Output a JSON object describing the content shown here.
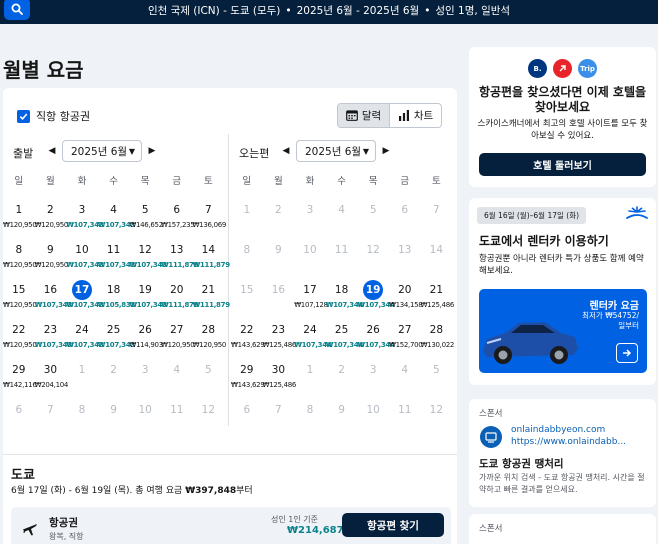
{
  "header": {
    "route": "인천 국제 (ICN) - 도쿄 (모두)",
    "dates": "2025년 6월 - 2025년 6월",
    "travellers": "성인 1명, 일반석"
  },
  "page_title": "월별 요금",
  "filters": {
    "direct_label": "직항 항공권",
    "direct_checked": true,
    "view_calendar": "달력",
    "view_chart": "차트"
  },
  "weekdays": [
    "일",
    "월",
    "화",
    "수",
    "목",
    "금",
    "토"
  ],
  "outbound": {
    "label": "출발",
    "month": "2025년 6월",
    "rows": [
      [
        {
          "d": "1",
          "p": "₩120,950"
        },
        {
          "d": "2",
          "p": "₩120,950"
        },
        {
          "d": "3",
          "p": "₩107,343",
          "g": true
        },
        {
          "d": "4",
          "p": "₩107,343",
          "g": true
        },
        {
          "d": "5",
          "p": "₩146,652"
        },
        {
          "d": "6",
          "p": "₩157,235"
        },
        {
          "d": "7",
          "p": "₩136,069"
        }
      ],
      [
        {
          "d": "8",
          "p": "₩120,950"
        },
        {
          "d": "9",
          "p": "₩120,950"
        },
        {
          "d": "10",
          "p": "₩107,343",
          "g": true
        },
        {
          "d": "11",
          "p": "₩107,343",
          "g": true
        },
        {
          "d": "12",
          "p": "₩107,343",
          "g": true
        },
        {
          "d": "13",
          "p": "₩111,879",
          "g": true
        },
        {
          "d": "14",
          "p": "₩111,879",
          "g": true
        }
      ],
      [
        {
          "d": "15",
          "p": "₩120,950"
        },
        {
          "d": "16",
          "p": "₩107,343",
          "g": true
        },
        {
          "d": "17",
          "p": "₩107,343",
          "g": true,
          "sel": true
        },
        {
          "d": "18",
          "p": "₩105,831",
          "g": true
        },
        {
          "d": "19",
          "p": "₩107,343",
          "g": true
        },
        {
          "d": "20",
          "p": "₩111,879",
          "g": true
        },
        {
          "d": "21",
          "p": "₩111,879",
          "g": true
        }
      ],
      [
        {
          "d": "22",
          "p": "₩120,950"
        },
        {
          "d": "23",
          "p": "₩107,343",
          "g": true
        },
        {
          "d": "24",
          "p": "₩107,343",
          "g": true
        },
        {
          "d": "25",
          "p": "₩107,343",
          "g": true
        },
        {
          "d": "26",
          "p": "₩114,903"
        },
        {
          "d": "27",
          "p": "₩120,950"
        },
        {
          "d": "28",
          "p": "₩120,950"
        }
      ],
      [
        {
          "d": "29",
          "p": "₩142,116"
        },
        {
          "d": "30",
          "p": "₩204,104"
        },
        {
          "d": "1",
          "dim": true
        },
        {
          "d": "2",
          "dim": true
        },
        {
          "d": "3",
          "dim": true
        },
        {
          "d": "4",
          "dim": true
        },
        {
          "d": "5",
          "dim": true
        }
      ],
      [
        {
          "d": "6",
          "dim": true
        },
        {
          "d": "7",
          "dim": true
        },
        {
          "d": "8",
          "dim": true
        },
        {
          "d": "9",
          "dim": true
        },
        {
          "d": "10",
          "dim": true
        },
        {
          "d": "11",
          "dim": true
        },
        {
          "d": "12",
          "dim": true
        }
      ]
    ]
  },
  "inbound": {
    "label": "오는편",
    "month": "2025년 6월",
    "rows": [
      [
        {
          "d": "1",
          "dim": true
        },
        {
          "d": "2",
          "dim": true
        },
        {
          "d": "3",
          "dim": true
        },
        {
          "d": "4",
          "dim": true
        },
        {
          "d": "5",
          "dim": true
        },
        {
          "d": "6",
          "dim": true
        },
        {
          "d": "7",
          "dim": true
        }
      ],
      [
        {
          "d": "8",
          "dim": true
        },
        {
          "d": "9",
          "dim": true
        },
        {
          "d": "10",
          "dim": true
        },
        {
          "d": "11",
          "dim": true
        },
        {
          "d": "12",
          "dim": true
        },
        {
          "d": "13",
          "dim": true
        },
        {
          "d": "14",
          "dim": true
        }
      ],
      [
        {
          "d": "15",
          "dim": true
        },
        {
          "d": "16",
          "dim": true
        },
        {
          "d": "17",
          "p": "₩107,128"
        },
        {
          "d": "18",
          "p": "₩107,344",
          "g": true
        },
        {
          "d": "19",
          "p": "₩107,344",
          "g": true,
          "sel": true
        },
        {
          "d": "20",
          "p": "₩134,158"
        },
        {
          "d": "21",
          "p": "₩125,486"
        }
      ],
      [
        {
          "d": "22",
          "p": "₩143,629"
        },
        {
          "d": "23",
          "p": "₩125,486"
        },
        {
          "d": "24",
          "p": "₩107,344",
          "g": true
        },
        {
          "d": "25",
          "p": "₩107,344",
          "g": true
        },
        {
          "d": "26",
          "p": "₩107,344",
          "g": true
        },
        {
          "d": "27",
          "p": "₩152,700"
        },
        {
          "d": "28",
          "p": "₩130,022"
        }
      ],
      [
        {
          "d": "29",
          "p": "₩143,629"
        },
        {
          "d": "30",
          "p": "₩125,486"
        },
        {
          "d": "1",
          "dim": true
        },
        {
          "d": "2",
          "dim": true
        },
        {
          "d": "3",
          "dim": true
        },
        {
          "d": "4",
          "dim": true
        },
        {
          "d": "5",
          "dim": true
        }
      ],
      [
        {
          "d": "6",
          "dim": true
        },
        {
          "d": "7",
          "dim": true
        },
        {
          "d": "8",
          "dim": true
        },
        {
          "d": "9",
          "dim": true
        },
        {
          "d": "10",
          "dim": true
        },
        {
          "d": "11",
          "dim": true
        },
        {
          "d": "12",
          "dim": true
        }
      ]
    ]
  },
  "summary": {
    "city": "도쿄",
    "dates_text": "6월 17일 (화) - 6월 19일 (목). 총 여행 요금 ",
    "total": "₩397,848",
    "total_suffix": "부터",
    "flight_title": "항공권",
    "flight_sub": "왕복, 직항",
    "from_label": "성인 1인 기준",
    "from_price": "₩214,687",
    "find_button": "항공편 찾기"
  },
  "hotel_promo": {
    "logos": [
      "B.",
      "Trip"
    ],
    "title": "항공편을 찾으셨다면 이제 호텔을 찾아보세요",
    "desc": "스카이스캐너에서 최고의 호텔 사이트를 모두 찾아보실 수 있어요.",
    "button": "호텔 둘러보기"
  },
  "car_promo": {
    "date_pill": "6월 16일 (월)–6월 17일 (화)",
    "title": "도쿄에서 렌터카 이용하기",
    "desc": "항공권뿐 아니라 렌터카 특가 상품도 함께 예약해보세요.",
    "banner_title": "렌터카 요금",
    "banner_sub1": "최저가 ₩54752/",
    "banner_sub2": "일부터"
  },
  "sponsor": {
    "label": "스폰서",
    "domain": "onlaindabbyeon.com",
    "url": "https://www.onlaindabb...",
    "title": "도쿄 항공권 땡처리",
    "desc": "가까운 위치 검색 - 도쿄 항공권 땡처리. 시간을 절약하고 빠른 결과를 얻으세요."
  },
  "sponsor2": {
    "label": "스폰서"
  },
  "colors": {
    "brand_dark": "#05203c",
    "brand_blue": "#0062e3",
    "cheap_green": "#0c838a"
  }
}
